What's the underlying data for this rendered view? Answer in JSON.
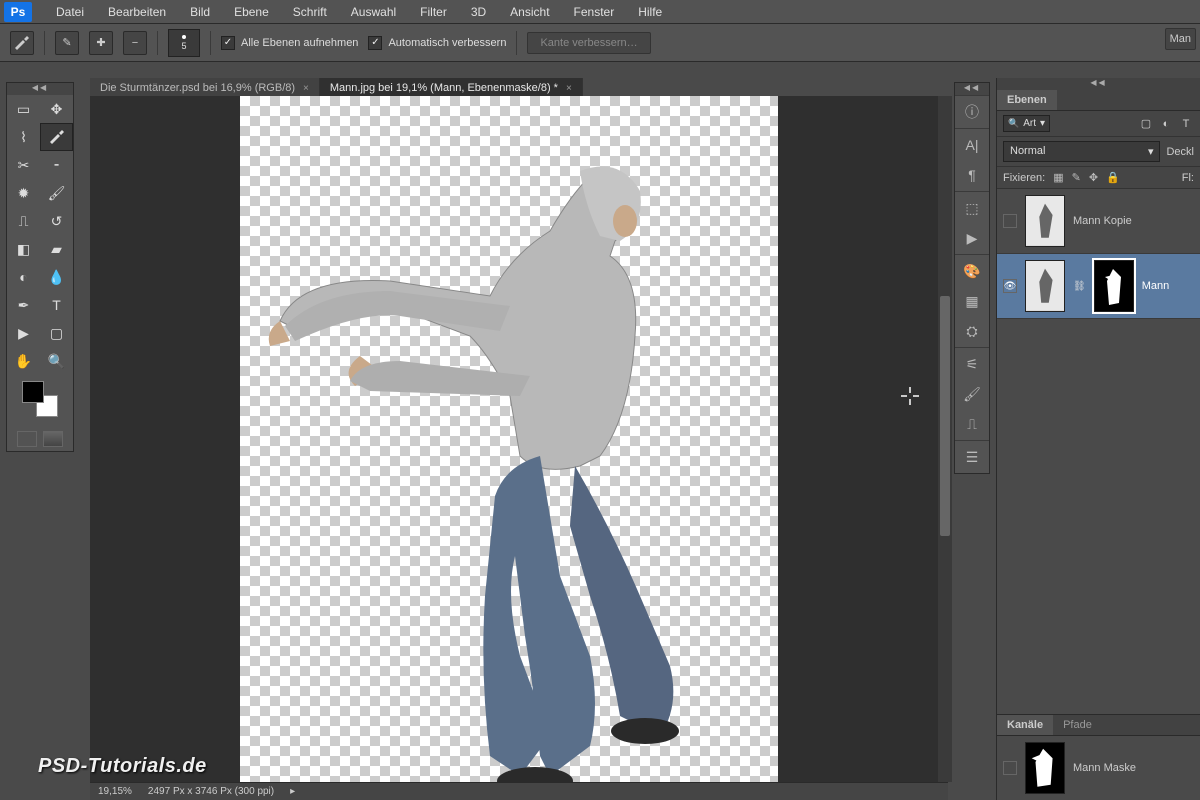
{
  "app": {
    "logo": "Ps"
  },
  "menu": [
    "Datei",
    "Bearbeiten",
    "Bild",
    "Ebene",
    "Schrift",
    "Auswahl",
    "Filter",
    "3D",
    "Ansicht",
    "Fenster",
    "Hilfe"
  ],
  "options": {
    "brush_size": "5",
    "chk_all_layers": "Alle Ebenen aufnehmen",
    "chk_auto_enhance": "Automatisch verbessern",
    "refine_edge": "Kante verbessern…",
    "right_btn": "Man"
  },
  "tabs": [
    {
      "label": "Die Sturmtänzer.psd bei 16,9% (RGB/8)",
      "active": false
    },
    {
      "label": "Mann.jpg bei 19,1% (Mann, Ebenenmaske/8) *",
      "active": true
    }
  ],
  "layers_panel": {
    "title": "Ebenen",
    "kind": "Art",
    "blend_mode": "Normal",
    "opacity_label": "Deckl",
    "lock_label": "Fixieren:",
    "fill_label": "Fl:",
    "layers": [
      {
        "name": "Mann Kopie",
        "visible": false,
        "selected": false,
        "has_mask": false
      },
      {
        "name": "Mann",
        "visible": true,
        "selected": true,
        "has_mask": true
      }
    ]
  },
  "channels_panel": {
    "tabs": [
      "Kanäle",
      "Pfade"
    ],
    "active_tab": "Kanäle",
    "channel_name": "Mann Maske"
  },
  "status": {
    "zoom": "19,15%",
    "dims": "2497 Px x 3746 Px (300 ppi)"
  },
  "watermark": "PSD-Tutorials.de",
  "colors": {
    "foreground": "#000000",
    "background": "#ffffff",
    "selection": "#5a7aa0"
  }
}
